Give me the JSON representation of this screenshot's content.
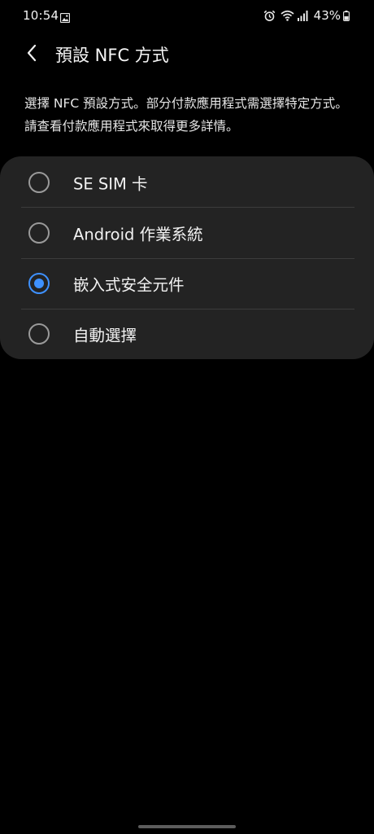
{
  "status_bar": {
    "time": "10:54",
    "battery": "43%",
    "icons": [
      "gallery-icon",
      "alarm-icon",
      "wifi-icon",
      "signal-icon",
      "battery-icon"
    ]
  },
  "header": {
    "back_icon": "chevron-left-icon",
    "title": "預設 NFC 方式"
  },
  "description": "選擇 NFC 預設方式。部分付款應用程式需選擇特定方式。請查看付款應用程式來取得更多詳情。",
  "options": [
    {
      "label": "SE SIM 卡",
      "selected": false
    },
    {
      "label": "Android 作業系統",
      "selected": false
    },
    {
      "label": "嵌入式安全元件",
      "selected": true
    },
    {
      "label": "自動選擇",
      "selected": false
    }
  ],
  "colors": {
    "background": "#000000",
    "card": "#232323",
    "accent": "#3e91ff",
    "radio_unselected": "#9a9a9a",
    "divider": "#3c3c3c"
  }
}
